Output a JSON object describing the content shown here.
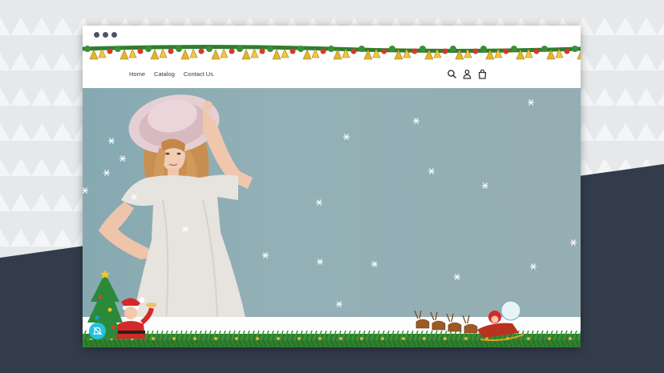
{
  "nav": {
    "home_label": "Home",
    "catalog_label": "Catalog",
    "contact_label": "Contact Us"
  },
  "header_icons": [
    "search-icon",
    "account-icon",
    "cart-icon"
  ],
  "colors": {
    "navy": "#323c4b",
    "hero_bg": "#93b0b6",
    "notification": "#27c1e0"
  }
}
